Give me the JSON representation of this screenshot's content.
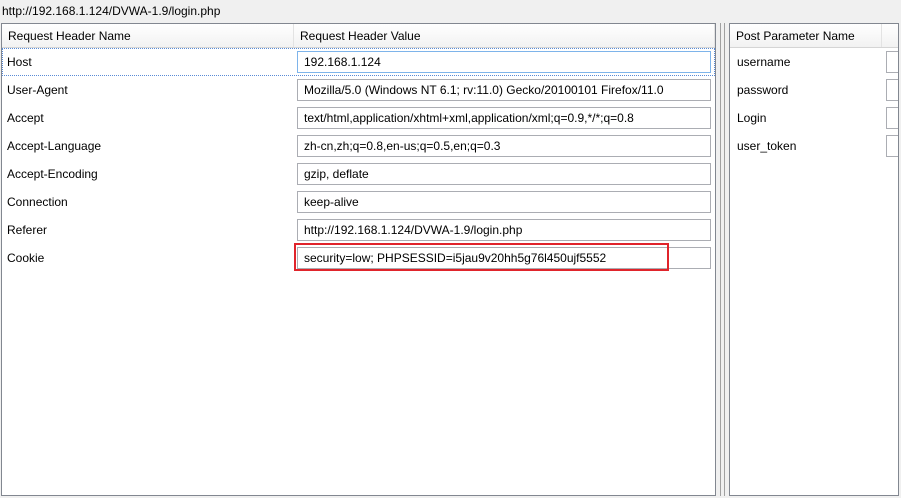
{
  "url": "http://192.168.1.124/DVWA-1.9/login.php",
  "headers_table": {
    "columns": [
      "Request Header Name",
      "Request Header Value"
    ],
    "rows": [
      {
        "name": "Host",
        "value": "192.168.1.124"
      },
      {
        "name": "User-Agent",
        "value": "Mozilla/5.0 (Windows NT 6.1; rv:11.0) Gecko/20100101 Firefox/11.0"
      },
      {
        "name": "Accept",
        "value": "text/html,application/xhtml+xml,application/xml;q=0.9,*/*;q=0.8"
      },
      {
        "name": "Accept-Language",
        "value": "zh-cn,zh;q=0.8,en-us;q=0.5,en;q=0.3"
      },
      {
        "name": "Accept-Encoding",
        "value": "gzip, deflate"
      },
      {
        "name": "Connection",
        "value": "keep-alive"
      },
      {
        "name": "Referer",
        "value": "http://192.168.1.124/DVWA-1.9/login.php"
      },
      {
        "name": "Cookie",
        "value": "security=low; PHPSESSID=i5jau9v20hh5g76l450ujf5552"
      }
    ]
  },
  "post_table": {
    "columns": [
      "Post Parameter Name"
    ],
    "rows": [
      {
        "name": "username"
      },
      {
        "name": "password"
      },
      {
        "name": "Login"
      },
      {
        "name": "user_token"
      }
    ]
  },
  "colors": {
    "highlight": "#e0242b",
    "border": "#828790",
    "focus": "#7eb4ea"
  }
}
